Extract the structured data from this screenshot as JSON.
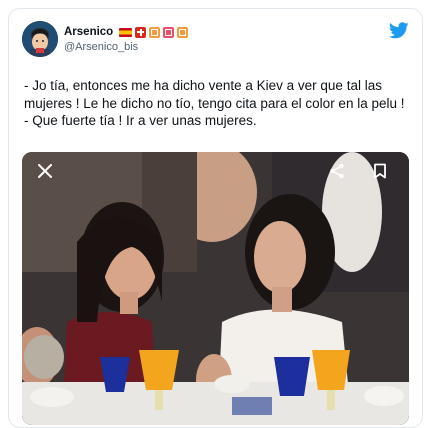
{
  "user": {
    "display_name": "Arsenico",
    "handle": "@Arsenico_bis",
    "badges": [
      "spain-flag-emoji",
      "swiss-flag-emoji",
      "kanji-emoji",
      "kanji-emoji",
      "kanji-emoji"
    ]
  },
  "tweet": {
    "lines": [
      "- Jo tía,  entonces me ha dicho vente a Kiev a ver que tal las mujeres ! Le he dicho no tío, tengo cita para el color en la pelu !",
      "- Que fuerte tía ! Ir a ver unas mujeres."
    ]
  },
  "media": {
    "close_icon": "close-icon",
    "share_icon": "share-icon",
    "bookmark_icon": "bookmark-icon"
  },
  "colors": {
    "twitter_blue": "#1d9bf0",
    "text": "#0f1419",
    "secondary_text": "#536471",
    "border": "#e1e8ed"
  }
}
